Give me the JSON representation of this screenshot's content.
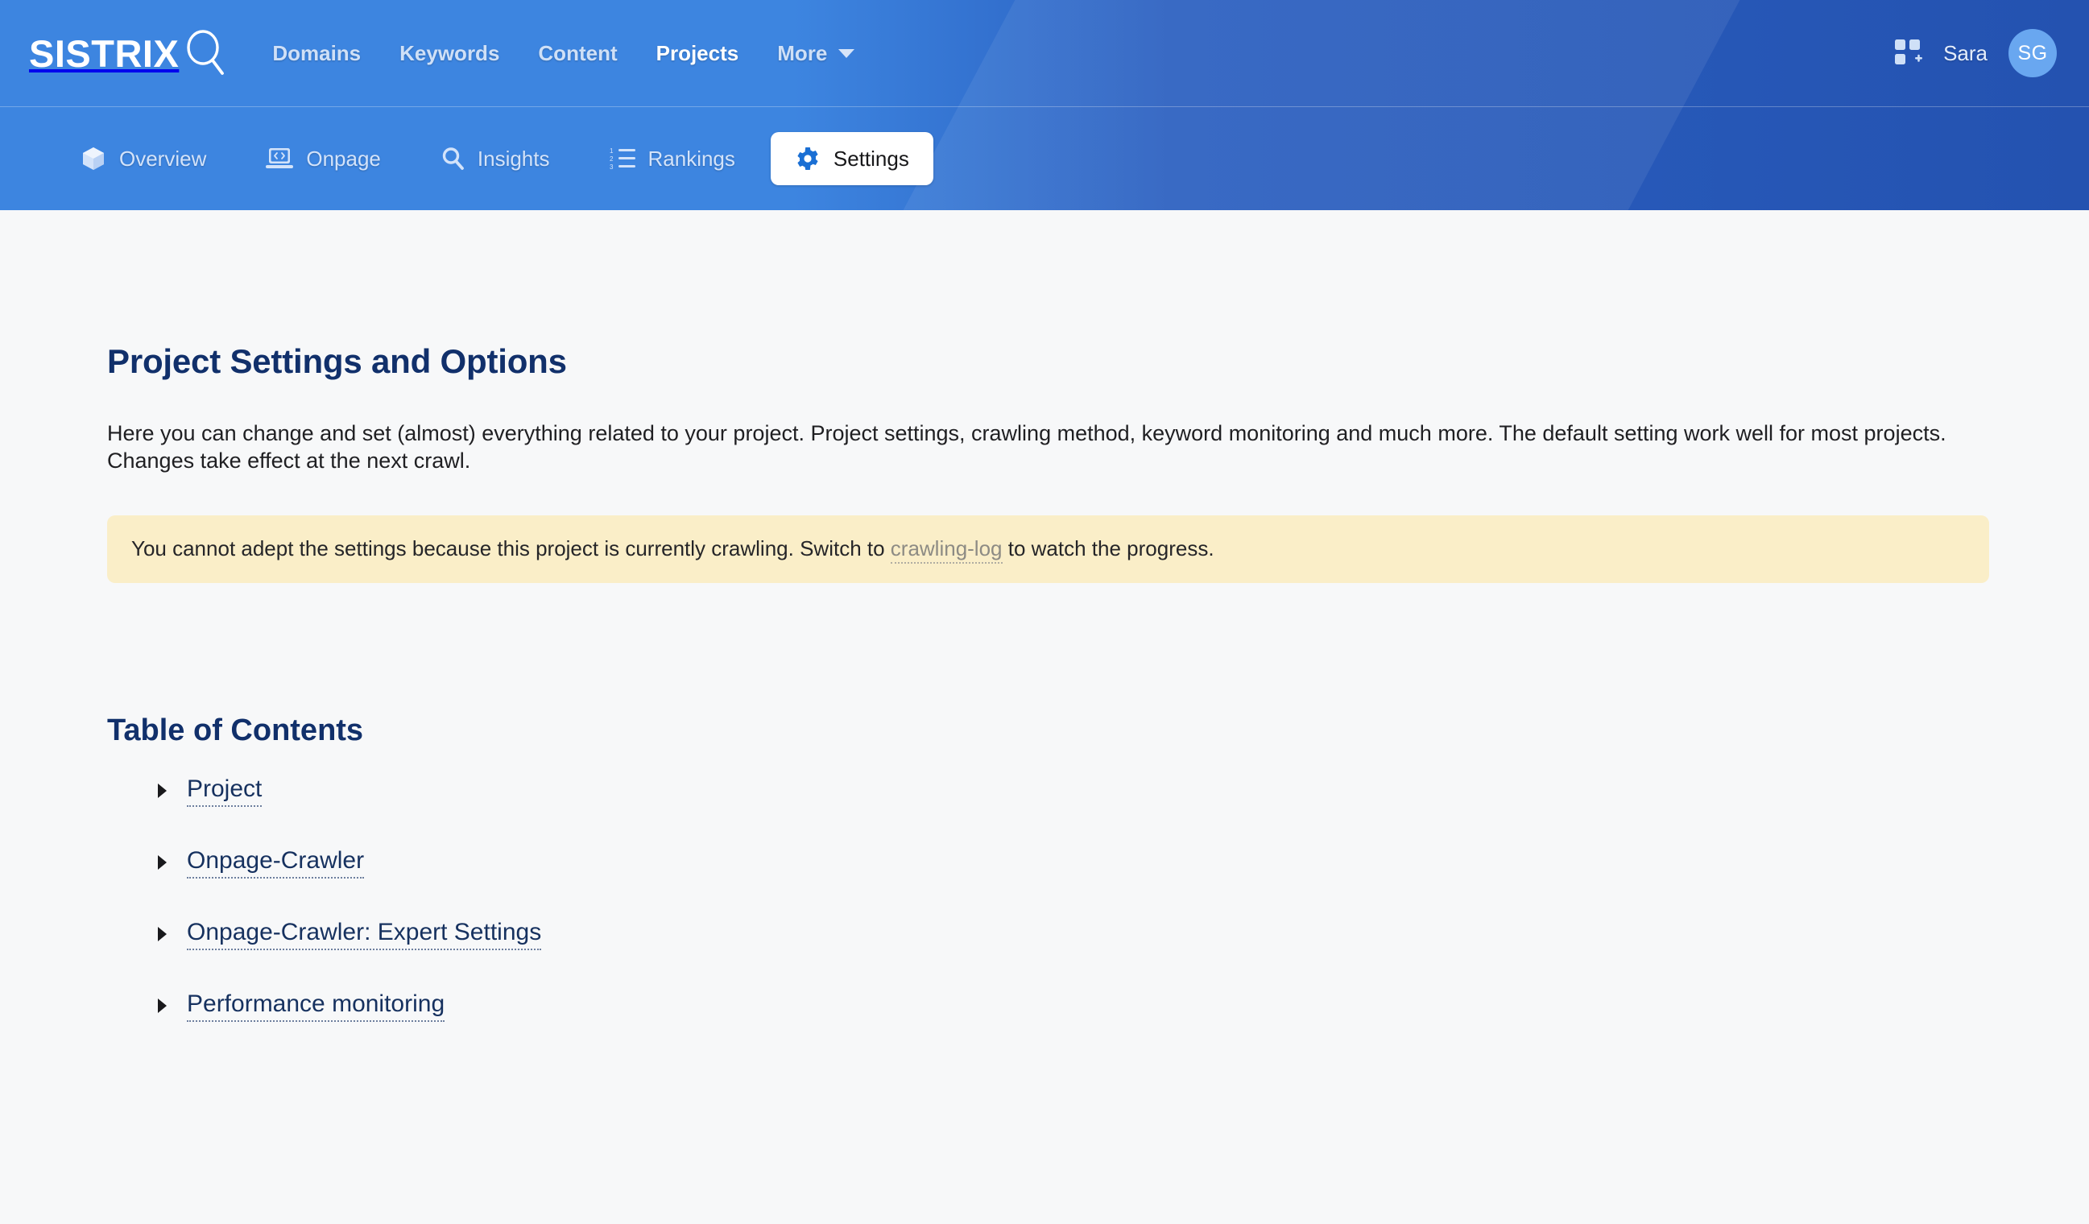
{
  "brand": {
    "logo_text": "SISTRIX",
    "logo_icon": "magnifier-icon"
  },
  "header": {
    "nav": [
      {
        "label": "Domains",
        "active": false
      },
      {
        "label": "Keywords",
        "active": false
      },
      {
        "label": "Content",
        "active": false
      },
      {
        "label": "Projects",
        "active": true
      },
      {
        "label": "More",
        "active": false,
        "caret": true
      }
    ],
    "user": {
      "apps_icon": "grid-add-icon",
      "name": "Sara",
      "avatar_initials": "SG"
    },
    "accent_light": "#3d85e0",
    "accent_dark": "#2452b0"
  },
  "subnav": {
    "items": [
      {
        "label": "Overview",
        "icon": "cube-icon",
        "active": false
      },
      {
        "label": "Onpage",
        "icon": "laptop-code-icon",
        "active": false
      },
      {
        "label": "Insights",
        "icon": "magnifier-icon",
        "active": false
      },
      {
        "label": "Rankings",
        "icon": "numbered-list-icon",
        "active": false
      },
      {
        "label": "Settings",
        "icon": "gear-icon",
        "active": true
      }
    ]
  },
  "main": {
    "title": "Project Settings and Options",
    "intro": "Here you can change and set (almost) everything related to your project. Project settings, crawling method, keyword monitoring and much more. The default setting work well for most projects. Changes take effect at the next crawl.",
    "alert": {
      "text_before": "You cannot adept the settings because this project is currently crawling. Switch to ",
      "link_text": "crawling-log",
      "text_after": " to watch the progress.",
      "background": "#faeec8"
    },
    "toc": {
      "title": "Table of Contents",
      "items": [
        {
          "label": "Project"
        },
        {
          "label": "Onpage-Crawler"
        },
        {
          "label": "Onpage-Crawler: Expert Settings"
        },
        {
          "label": "Performance monitoring"
        }
      ]
    }
  }
}
